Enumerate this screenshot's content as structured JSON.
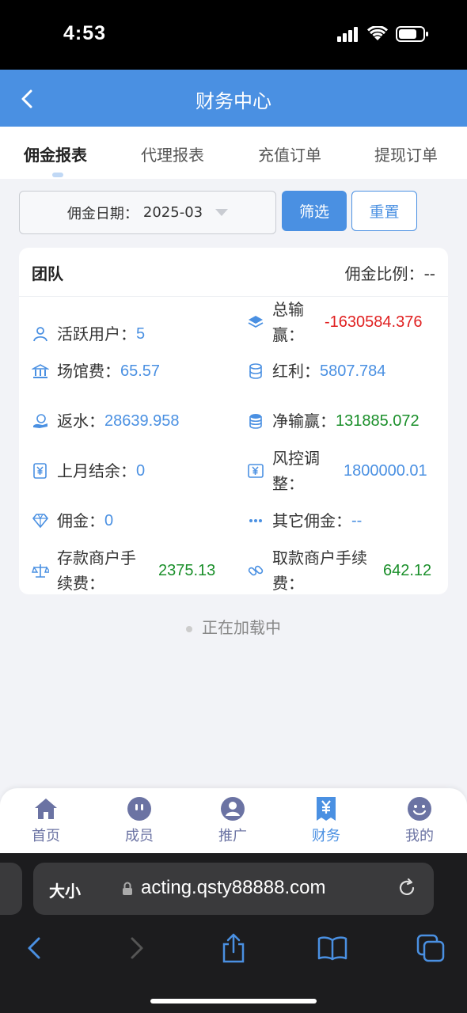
{
  "status": {
    "time": "4:53"
  },
  "header": {
    "title": "财务中心"
  },
  "tabs": [
    {
      "label": "佣金报表",
      "active": true
    },
    {
      "label": "代理报表",
      "active": false
    },
    {
      "label": "充值订单",
      "active": false
    },
    {
      "label": "提现订单",
      "active": false
    }
  ],
  "filter": {
    "date_label": "佣金日期：",
    "date_value": "2025-03",
    "filter_button": "筛选",
    "reset_button": "重置"
  },
  "card": {
    "title": "团队",
    "ratio_label": "佣金比例：",
    "ratio_value": "--",
    "stats": [
      {
        "label": "活跃用户：",
        "value": "5",
        "color": "#4a90e2",
        "icon": "user-icon"
      },
      {
        "label": "总输\n赢：",
        "value": "-1630584.376",
        "color": "#e02020",
        "icon": "layers-icon"
      },
      {
        "label": "场馆费：",
        "value": "65.57",
        "color": "#4a90e2",
        "icon": "bank-icon"
      },
      {
        "label": "红利：",
        "value": "5807.784",
        "color": "#4a90e2",
        "icon": "coins-icon"
      },
      {
        "label": "返水：",
        "value": "28639.958",
        "color": "#4a90e2",
        "icon": "hand-coin-icon"
      },
      {
        "label": "净输赢：",
        "value": "131885.072",
        "color": "#1a8f2a",
        "icon": "coin-stack-icon"
      },
      {
        "label": "上月结余：",
        "value": "0",
        "color": "#4a90e2",
        "icon": "yen-doc-icon"
      },
      {
        "label": "风控调\n整：",
        "value": "1800000.01",
        "color": "#4a90e2",
        "icon": "yen-card-icon"
      },
      {
        "label": "佣金：",
        "value": "0",
        "color": "#4a90e2",
        "icon": "diamond-icon"
      },
      {
        "label": "其它佣金：",
        "value": "--",
        "color": "#4a90e2",
        "icon": "more-icon"
      },
      {
        "label": "存款商户手\n续费：",
        "value": "2375.13",
        "color": "#1a8f2a",
        "icon": "scale-icon"
      },
      {
        "label": "取款商户手续\n费：",
        "value": "642.12",
        "color": "#1a8f2a",
        "icon": "link-icon"
      }
    ]
  },
  "loading_text": "正在加载中",
  "tabbar": [
    {
      "label": "首页",
      "icon": "home-icon",
      "active": false
    },
    {
      "label": "成员",
      "icon": "members-icon",
      "active": false
    },
    {
      "label": "推广",
      "icon": "promote-icon",
      "active": false
    },
    {
      "label": "财务",
      "icon": "finance-icon",
      "active": true
    },
    {
      "label": "我的",
      "icon": "profile-icon",
      "active": false
    }
  ],
  "browser": {
    "text_size_label": "大小",
    "url": "acting.qsty88888.com"
  },
  "colors": {
    "primary": "#4a90e2",
    "negative": "#e02020",
    "positive": "#1a8f2a"
  }
}
